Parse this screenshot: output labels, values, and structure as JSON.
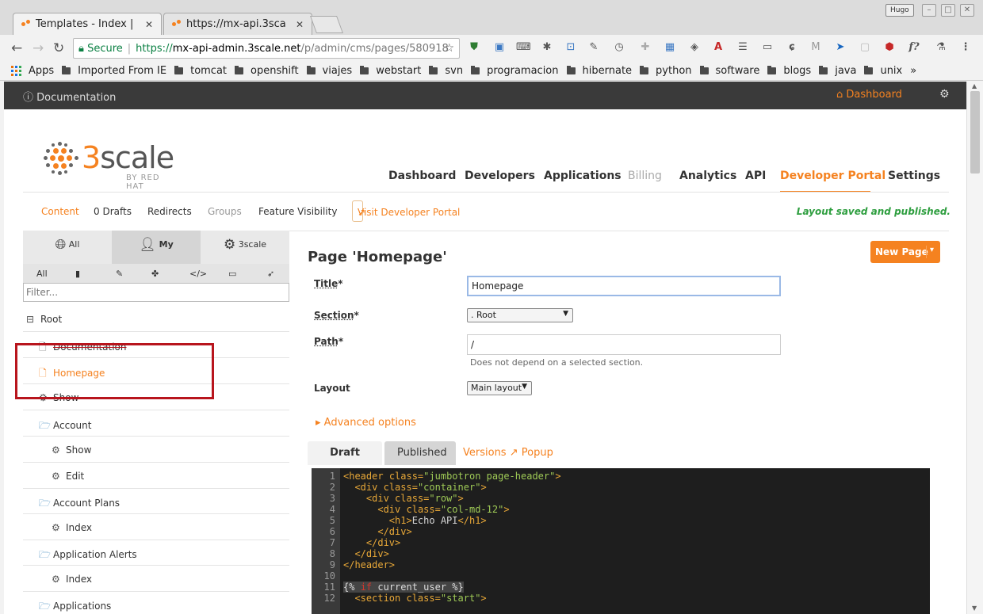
{
  "browser": {
    "tabs": [
      {
        "title": "Templates - Index |",
        "close": "✕"
      },
      {
        "title": "https://mx-api.3sca",
        "close": "✕"
      }
    ],
    "user_badge": "Hugo",
    "address": {
      "secure_label": "Secure",
      "scheme": "https://",
      "host": "mx-api-admin.3scale.net",
      "path": "/p/admin/cms/pages/580918"
    },
    "bookmarks": {
      "apps": "Apps",
      "folders": [
        "Imported From IE",
        "tomcat",
        "openshift",
        "viajes",
        "webstart",
        "svn",
        "programacion",
        "hibernate",
        "python",
        "software",
        "blogs",
        "java",
        "unix"
      ],
      "more": "»"
    }
  },
  "topbar": {
    "documentation": "Documentation",
    "dashboard": "Dashboard"
  },
  "brand": {
    "name": "scale",
    "digit": "3",
    "tagline": "BY RED HAT"
  },
  "main_nav": {
    "items": [
      "Dashboard",
      "Developers",
      "Applications",
      "Billing",
      "Analytics",
      "API",
      "Developer Portal",
      "Settings"
    ],
    "active": "Developer Portal",
    "disabled": "Billing"
  },
  "sub_nav": {
    "items": [
      "Content",
      "0 Drafts",
      "Redirects",
      "Groups",
      "Feature Visibility"
    ],
    "visit_portal": "Visit Developer Portal",
    "status": "Layout saved and published."
  },
  "sidebar": {
    "tabs": [
      "All",
      "My",
      "3scale"
    ],
    "filters": [
      "All"
    ],
    "filter_placeholder": "Filter...",
    "root": "Root",
    "tree": [
      {
        "label": "Documentation",
        "level": 1,
        "type": "page"
      },
      {
        "label": "Homepage",
        "level": 1,
        "type": "page"
      },
      {
        "label": "Show",
        "level": 1,
        "type": "builtin"
      },
      {
        "label": "Account",
        "level": 1,
        "type": "folder"
      },
      {
        "label": "Show",
        "level": 2,
        "type": "builtin"
      },
      {
        "label": "Edit",
        "level": 2,
        "type": "builtin"
      },
      {
        "label": "Account Plans",
        "level": 1,
        "type": "folder"
      },
      {
        "label": "Index",
        "level": 2,
        "type": "builtin"
      },
      {
        "label": "Application Alerts",
        "level": 1,
        "type": "folder"
      },
      {
        "label": "Index",
        "level": 2,
        "type": "builtin"
      },
      {
        "label": "Applications",
        "level": 1,
        "type": "folder"
      }
    ]
  },
  "form": {
    "page_title": "Page 'Homepage'",
    "new_page": "New Page",
    "title_label": "Title",
    "title_value": "Homepage",
    "section_label": "Section",
    "section_value": ". Root",
    "path_label": "Path",
    "path_value": "/",
    "path_hint": "Does not depend on a selected section.",
    "layout_label": "Layout",
    "layout_value": "Main layout",
    "required_mark": "*",
    "advanced": "Advanced options"
  },
  "editor": {
    "tabs": [
      "Draft",
      "Published"
    ],
    "versions": "Versions",
    "popup": "Popup",
    "lines": [
      "1",
      "2",
      "3",
      "4",
      "5",
      "6",
      "7",
      "8",
      "9",
      "10",
      "11",
      "12"
    ]
  }
}
